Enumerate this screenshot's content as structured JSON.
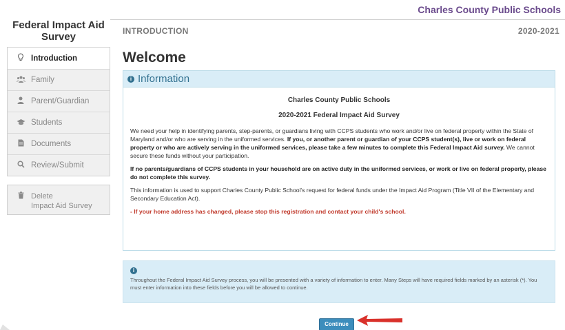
{
  "district_name": "Charles County Public Schools",
  "sidebar": {
    "title": "Federal Impact Aid Survey",
    "items": [
      {
        "label": "Introduction",
        "icon": "lightbulb-icon",
        "active": true
      },
      {
        "label": "Family",
        "icon": "users-icon",
        "active": false
      },
      {
        "label": "Parent/Guardian",
        "icon": "user-icon",
        "active": false
      },
      {
        "label": "Students",
        "icon": "graduation-cap-icon",
        "active": false
      },
      {
        "label": "Documents",
        "icon": "document-icon",
        "active": false
      },
      {
        "label": "Review/Submit",
        "icon": "search-icon",
        "active": false
      }
    ],
    "delete": {
      "line1": "Delete",
      "line2": "Impact Aid Survey",
      "icon": "trash-icon"
    }
  },
  "header": {
    "section": "INTRODUCTION",
    "year": "2020-2021"
  },
  "welcome": "Welcome",
  "info_panel": {
    "heading": "Information",
    "title1": "Charles County Public Schools",
    "title2": "2020-2021 Federal Impact Aid Survey",
    "p1_a": "We need your help in identifying parents, step-parents, or guardians living with CCPS students who work and/or live on federal property within the State of Maryland and/or who are serving in the uniformed services. ",
    "p1_b": "If you, or another parent or guardian of your CCPS student(s), live or work on federal property or who are actively serving in the uniformed services, please take a few minutes to complete this Federal Impact Aid survey.",
    "p1_c": " We cannot secure these funds without your participation.",
    "p2": "If no parents/guardians of CCPS students in your household are on active duty in the uniformed services, or work or live on federal property, please do not complete this survey.",
    "p3": "This information is used to support Charles County Public School's request for federal funds under the Impact Aid Program (Title VII of the Elementary and Secondary Education Act).",
    "p4": "- If your home address has changed, please stop this registration and contact your child's school."
  },
  "note": {
    "text": "Throughout the Federal Impact Aid Survey process, you will be presented with a variety of information to enter. Many Steps will have required fields marked by an asterisk (*). You must enter information into these fields before you will be allowed to continue."
  },
  "continue_label": "Continue",
  "colors": {
    "accent": "#31708f",
    "button": "#3c8dbc",
    "arrow": "#d9312b",
    "district": "#6a4a8c"
  }
}
